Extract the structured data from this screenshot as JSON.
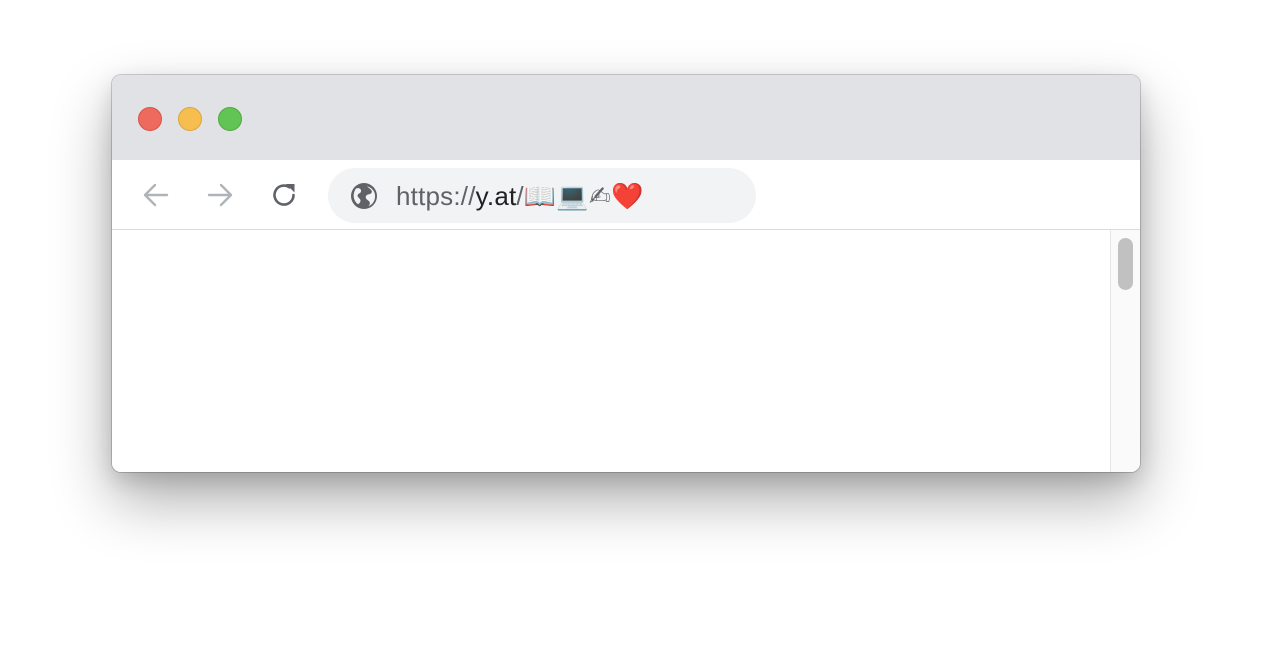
{
  "window": {
    "controls": {
      "close_color": "#ee6a5f",
      "minimize_color": "#f6be4f",
      "zoom_color": "#62c454"
    }
  },
  "toolbar": {
    "back_icon": "arrow-left-icon",
    "forward_icon": "arrow-right-icon",
    "reload_icon": "reload-icon",
    "address": {
      "site_icon": "globe-icon",
      "scheme": "https://",
      "host": "y.at",
      "path": "/📖💻✍❤️"
    }
  },
  "scrollbar": {
    "position_fraction": 0.0
  }
}
